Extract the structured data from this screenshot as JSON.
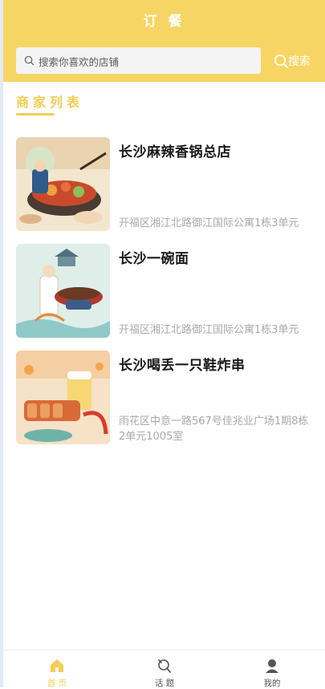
{
  "header": {
    "title": "订 餐"
  },
  "search": {
    "placeholder": "搜索你喜欢的店铺",
    "button_label": "搜索"
  },
  "section": {
    "title": "商家列表"
  },
  "stores": [
    {
      "name": "长沙麻辣香锅总店",
      "address": "开福区湘江北路御江国际公寓1栋3单元"
    },
    {
      "name": "长沙一碗面",
      "address": "开福区湘江北路御江国际公寓1栋3单元"
    },
    {
      "name": "长沙喝丢一只鞋炸串",
      "address": "雨花区中意一路567号佳兆业广场1期8栋2单元1005室"
    }
  ],
  "tabbar": {
    "items": [
      {
        "label": "首 页",
        "icon": "home-icon",
        "active": true
      },
      {
        "label": "话 题",
        "icon": "topic-icon",
        "active": false
      },
      {
        "label": "我的",
        "icon": "user-icon",
        "active": false
      }
    ]
  },
  "colors": {
    "header": "#f7d564",
    "accent": "#f3cd57",
    "active_tab": "#f3cd57",
    "inactive_tab": "#555555"
  }
}
